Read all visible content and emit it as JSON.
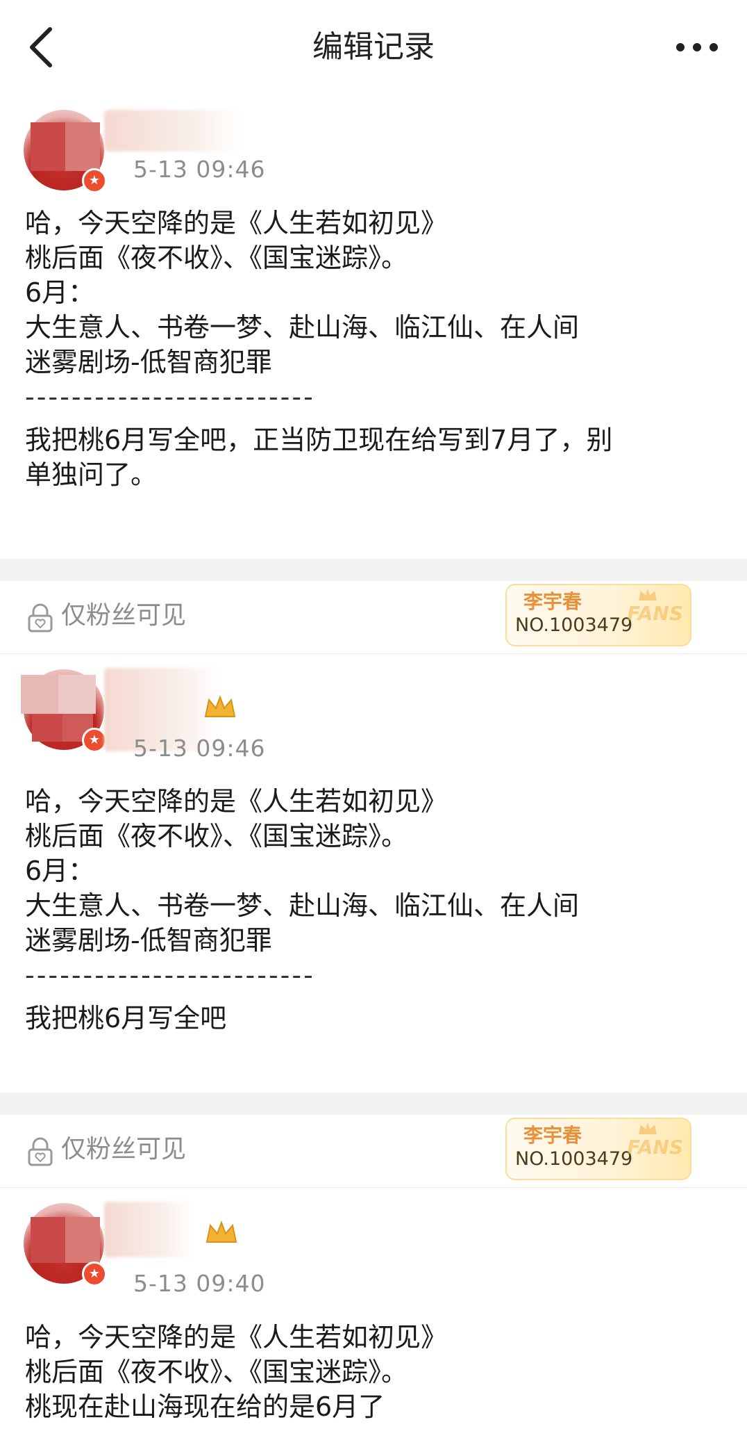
{
  "header": {
    "title": "编辑记录"
  },
  "posts": [
    {
      "time": "5-13 09:46",
      "lines": [
        "哈，今天空降的是《人生若如初见》",
        "桃后面《夜不收》、《国宝迷踪》。",
        "6月：",
        "大生意人、书卷一梦、赴山海、临江仙、在人间",
        "迷雾剧场-低智商犯罪",
        "-------------------------",
        "我把桃6月写全吧，正当防卫现在给写到7月了，别",
        "单独问了。"
      ]
    },
    {
      "visibility": "仅粉丝可见",
      "fan_badge": {
        "name": "李宇春",
        "number": "NO.1003479",
        "logo": "FANS"
      },
      "time": "5-13 09:46",
      "lines": [
        "哈，今天空降的是《人生若如初见》",
        "桃后面《夜不收》、《国宝迷踪》。",
        "6月：",
        "大生意人、书卷一梦、赴山海、临江仙、在人间",
        "迷雾剧场-低智商犯罪",
        "-------------------------",
        "我把桃6月写全吧"
      ]
    },
    {
      "visibility": "仅粉丝可见",
      "fan_badge": {
        "name": "李宇春",
        "number": "NO.1003479",
        "logo": "FANS"
      },
      "time": "5-13 09:40",
      "lines": [
        "哈，今天空降的是《人生若如初见》",
        "桃后面《夜不收》、《国宝迷踪》。",
        "桃现在赴山海现在给的是6月了"
      ]
    }
  ],
  "icons": {
    "back": "chevron-left-icon",
    "more": "more-horizontal-icon",
    "lock": "lock-heart-icon",
    "verified": "verified-badge-icon",
    "crown": "crown-icon"
  },
  "colors": {
    "accent": "#ee4c2f",
    "muted": "#8c8c8c",
    "gap": "#f2f2f2",
    "fan_orange": "#e8913a"
  }
}
